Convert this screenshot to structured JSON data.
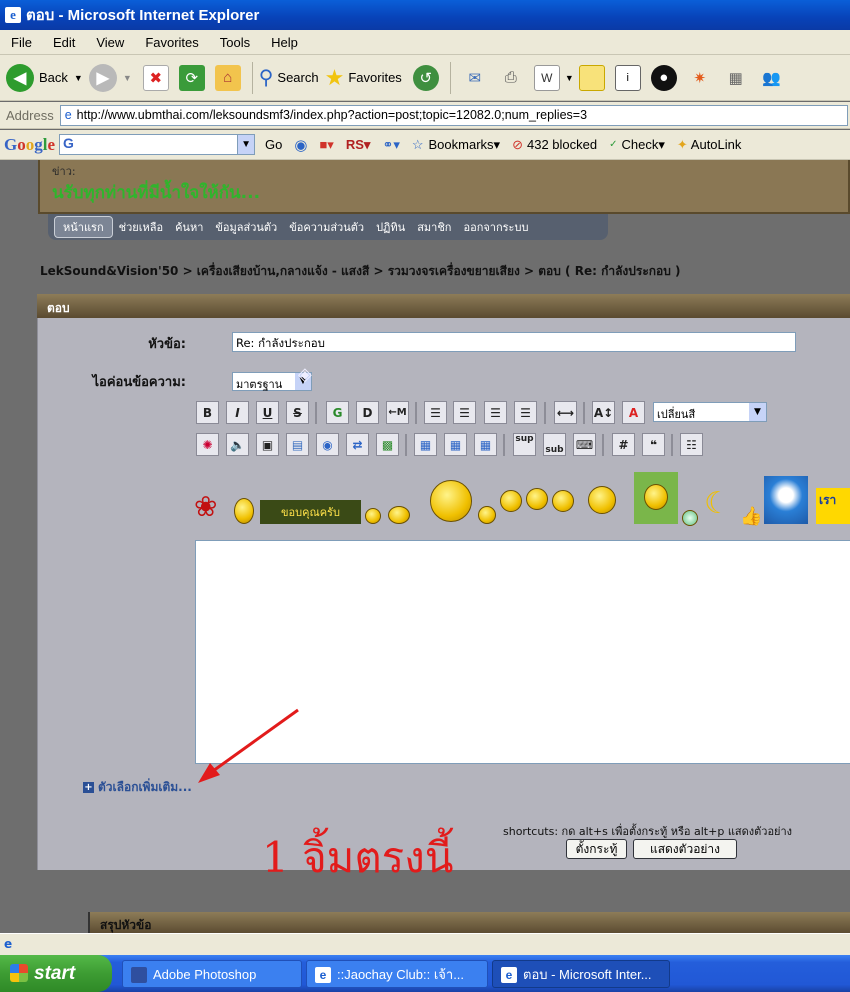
{
  "window": {
    "title": "ตอบ - Microsoft Internet Explorer"
  },
  "menu": [
    "File",
    "Edit",
    "View",
    "Favorites",
    "Tools",
    "Help"
  ],
  "toolbar": {
    "back": "Back",
    "search": "Search",
    "favorites": "Favorites"
  },
  "address": {
    "label": "Address",
    "url": "http://www.ubmthai.com/leksoundsmf3/index.php?action=post;topic=12082.0;num_replies=3"
  },
  "google": {
    "logo": "Google",
    "search_value": "G",
    "go": "Go",
    "rs": "RS",
    "bookmarks": "Bookmarks",
    "blocked": "432 blocked",
    "check": "Check",
    "autolink": "AutoLink"
  },
  "news": {
    "label": "ข่าว:",
    "message": "นรับทุกท่านที่มีน้ำใจให้กัน..."
  },
  "nav": [
    "หน้าแรก",
    "ช่วยเหลือ",
    "ค้นหา",
    "ข้อมูลส่วนตัว",
    "ข้อความส่วนตัว",
    "ปฏิทิน",
    "สมาชิก",
    "ออกจากระบบ"
  ],
  "breadcrumb": "LekSound&Vision'50 > เครื่องเสียงบ้าน,กลางแจ้ง - แสงสี > รวมวงจรเครื่องขยายเสียง > ตอบ ( Re: กำลังประกอบ )",
  "form": {
    "header": "ตอบ",
    "subject_label": "หัวข้อ:",
    "subject_value": "Re: กำลังประกอบ",
    "icon_label": "ไอค่อนข้อความ:",
    "icon_value": "มาตรฐาน",
    "color_value": "เปลี่ยนสี",
    "thanks_sticker": "ขอบคุณครับ",
    "more_options": "ตัวเลือกเพิ่มเติม...",
    "shortcuts": "shortcuts: กด alt+s เพื่อตั้งกระทู้ หรือ alt+p แสดงตัวอย่าง",
    "submit": "ตั้งกระทู้",
    "preview": "แสดงตัวอย่าง",
    "summary_header": "สรุปหัวข้อ"
  },
  "format_buttons": {
    "bold": "B",
    "italic": "I",
    "underline": "U",
    "strike": "S",
    "glow": "G",
    "shadow": "D",
    "move": "M",
    "sup": "sup",
    "sub": "sub",
    "hash": "#"
  },
  "annotation": "1 จิ้มตรงนี้",
  "taskbar": {
    "start": "start",
    "tasks": [
      "Adobe Photoshop",
      "::Jaochay Club:: เจ้า...",
      "ตอบ - Microsoft Inter..."
    ]
  },
  "colors": {
    "accent_red": "#e21b1b",
    "news_green": "#2fb52c",
    "header_brown": "#6e5c3c",
    "panel_gray": "#b4b4bd"
  }
}
